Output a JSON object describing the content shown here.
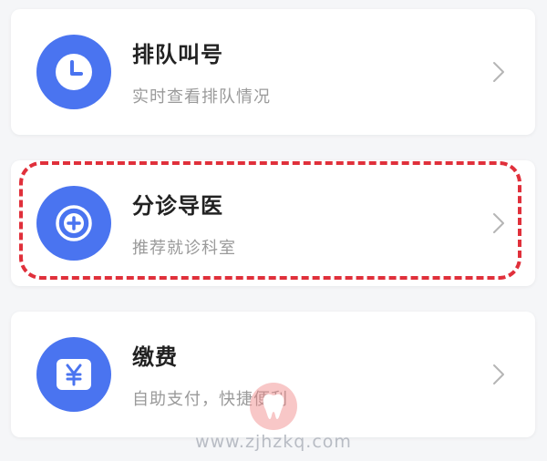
{
  "items": [
    {
      "title": "排队叫号",
      "subtitle": "实时查看排队情况",
      "icon": "clock-icon"
    },
    {
      "title": "分诊导医",
      "subtitle": "推荐就诊科室",
      "icon": "plus-circle-icon"
    },
    {
      "title": "缴费",
      "subtitle": "自助支付，快捷便利",
      "icon": "yuan-icon"
    }
  ],
  "watermark": {
    "text": "www.zjhzkq.com"
  },
  "colors": {
    "accent": "#4a74f0",
    "highlight": "#e0303b",
    "title": "#222222",
    "subtitle": "#9a9a9a"
  }
}
